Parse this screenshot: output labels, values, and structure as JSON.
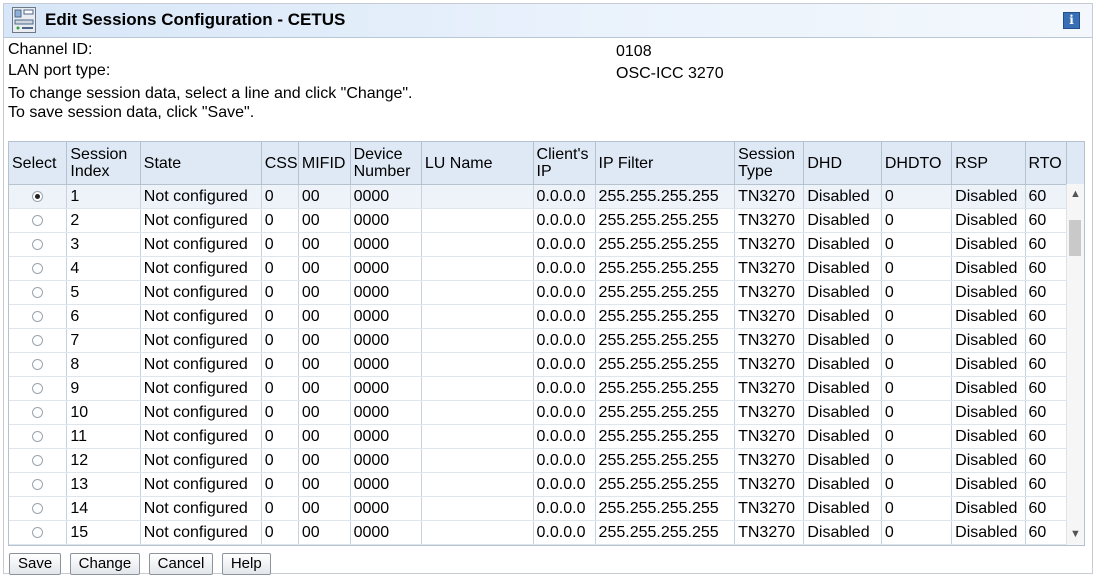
{
  "window": {
    "title": "Edit Sessions Configuration - CETUS",
    "info_icon": "info-icon",
    "app_icon": "hardware-console-icon"
  },
  "fields": {
    "channel_id_label": "Channel ID:",
    "channel_id_value": "0108",
    "lan_port_label": "LAN port type:",
    "lan_port_value": "OSC-ICC 3270"
  },
  "instructions": [
    "To change session data, select a line and click \"Change\".",
    "To save session data, click \"Save\"."
  ],
  "table": {
    "headers": [
      "Select",
      "Session Index",
      "State",
      "CSS",
      "MIFID",
      "Device Number",
      "LU Name",
      "Client's IP",
      "IP Filter",
      "Session Type",
      "DHD",
      "DHDTO",
      "RSP",
      "RTO"
    ],
    "selected_row": 0,
    "rows": [
      [
        "1",
        "Not configured",
        "0",
        "00",
        "0000",
        "",
        "0.0.0.0",
        "255.255.255.255",
        "TN3270",
        "Disabled",
        "0",
        "Disabled",
        "60"
      ],
      [
        "2",
        "Not configured",
        "0",
        "00",
        "0000",
        "",
        "0.0.0.0",
        "255.255.255.255",
        "TN3270",
        "Disabled",
        "0",
        "Disabled",
        "60"
      ],
      [
        "3",
        "Not configured",
        "0",
        "00",
        "0000",
        "",
        "0.0.0.0",
        "255.255.255.255",
        "TN3270",
        "Disabled",
        "0",
        "Disabled",
        "60"
      ],
      [
        "4",
        "Not configured",
        "0",
        "00",
        "0000",
        "",
        "0.0.0.0",
        "255.255.255.255",
        "TN3270",
        "Disabled",
        "0",
        "Disabled",
        "60"
      ],
      [
        "5",
        "Not configured",
        "0",
        "00",
        "0000",
        "",
        "0.0.0.0",
        "255.255.255.255",
        "TN3270",
        "Disabled",
        "0",
        "Disabled",
        "60"
      ],
      [
        "6",
        "Not configured",
        "0",
        "00",
        "0000",
        "",
        "0.0.0.0",
        "255.255.255.255",
        "TN3270",
        "Disabled",
        "0",
        "Disabled",
        "60"
      ],
      [
        "7",
        "Not configured",
        "0",
        "00",
        "0000",
        "",
        "0.0.0.0",
        "255.255.255.255",
        "TN3270",
        "Disabled",
        "0",
        "Disabled",
        "60"
      ],
      [
        "8",
        "Not configured",
        "0",
        "00",
        "0000",
        "",
        "0.0.0.0",
        "255.255.255.255",
        "TN3270",
        "Disabled",
        "0",
        "Disabled",
        "60"
      ],
      [
        "9",
        "Not configured",
        "0",
        "00",
        "0000",
        "",
        "0.0.0.0",
        "255.255.255.255",
        "TN3270",
        "Disabled",
        "0",
        "Disabled",
        "60"
      ],
      [
        "10",
        "Not configured",
        "0",
        "00",
        "0000",
        "",
        "0.0.0.0",
        "255.255.255.255",
        "TN3270",
        "Disabled",
        "0",
        "Disabled",
        "60"
      ],
      [
        "11",
        "Not configured",
        "0",
        "00",
        "0000",
        "",
        "0.0.0.0",
        "255.255.255.255",
        "TN3270",
        "Disabled",
        "0",
        "Disabled",
        "60"
      ],
      [
        "12",
        "Not configured",
        "0",
        "00",
        "0000",
        "",
        "0.0.0.0",
        "255.255.255.255",
        "TN3270",
        "Disabled",
        "0",
        "Disabled",
        "60"
      ],
      [
        "13",
        "Not configured",
        "0",
        "00",
        "0000",
        "",
        "0.0.0.0",
        "255.255.255.255",
        "TN3270",
        "Disabled",
        "0",
        "Disabled",
        "60"
      ],
      [
        "14",
        "Not configured",
        "0",
        "00",
        "0000",
        "",
        "0.0.0.0",
        "255.255.255.255",
        "TN3270",
        "Disabled",
        "0",
        "Disabled",
        "60"
      ],
      [
        "15",
        "Not configured",
        "0",
        "00",
        "0000",
        "",
        "0.0.0.0",
        "255.255.255.255",
        "TN3270",
        "Disabled",
        "0",
        "Disabled",
        "60"
      ]
    ]
  },
  "buttons": {
    "save": "Save",
    "change": "Change",
    "cancel": "Cancel",
    "help": "Help"
  }
}
